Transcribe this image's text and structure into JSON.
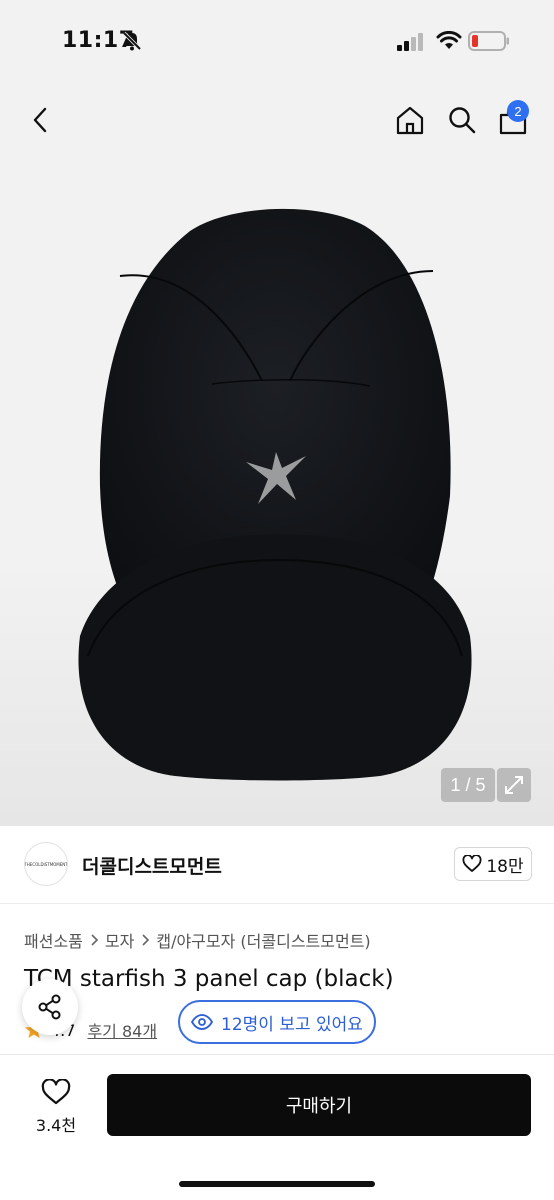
{
  "status_bar": {
    "time": "11:17"
  },
  "header": {
    "cart_count": "2"
  },
  "gallery": {
    "counter": "1 / 5"
  },
  "store": {
    "logo_text": "THECOLDISTMOMENT",
    "name": "더콜디스트모먼트",
    "likes": "18만"
  },
  "breadcrumb": [
    "패션소품",
    "모자",
    "캡/야구모자 (더콜디스트모먼트)"
  ],
  "product": {
    "title": "TCM starfish 3 panel cap (black)",
    "rating": "4.7",
    "reviews": "후기 84개"
  },
  "viewers": "12명이 보고 있어요",
  "bottom": {
    "wish_count": "3.4천",
    "buy_label": "구매하기"
  },
  "colors": {
    "accent_blue": "#2f6ff2",
    "buy_button": "#0b0b0b",
    "star": "#f5a623"
  }
}
